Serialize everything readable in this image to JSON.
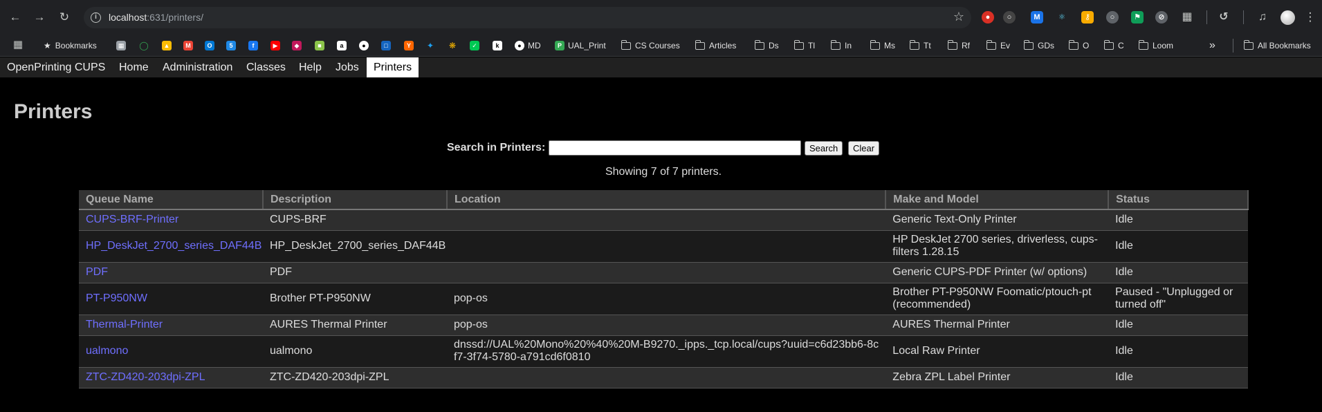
{
  "browser": {
    "url_host": "localhost",
    "url_rest": ":631/printers/",
    "bookmarks": [
      {
        "label": "Bookmarks",
        "type": "star"
      },
      {
        "label": "MD",
        "type": "favicon",
        "color": "#333"
      },
      {
        "label": "UAL_Print",
        "type": "favicon",
        "color": "#34a853"
      },
      {
        "label": "CS Courses",
        "type": "folder"
      },
      {
        "label": "Articles",
        "type": "folder"
      },
      {
        "label": "Ds",
        "type": "folder"
      },
      {
        "label": "Tl",
        "type": "folder"
      },
      {
        "label": "In",
        "type": "folder"
      },
      {
        "label": "Ms",
        "type": "folder"
      },
      {
        "label": "Tt",
        "type": "folder"
      },
      {
        "label": "Rf",
        "type": "folder"
      },
      {
        "label": "Ev",
        "type": "folder"
      },
      {
        "label": "GDs",
        "type": "folder"
      },
      {
        "label": "O",
        "type": "folder"
      },
      {
        "label": "C",
        "type": "folder"
      },
      {
        "label": "Loom",
        "type": "folder"
      }
    ],
    "all_bookmarks": "All Bookmarks"
  },
  "menu": {
    "brand": "OpenPrinting CUPS",
    "items": [
      "Home",
      "Administration",
      "Classes",
      "Help",
      "Jobs",
      "Printers"
    ],
    "active": "Printers"
  },
  "page": {
    "title": "Printers",
    "search_label": "Search in Printers:",
    "search_value": "",
    "search_button": "Search",
    "clear_button": "Clear",
    "showing": "Showing 7 of 7 printers."
  },
  "table": {
    "headers": [
      "Queue Name",
      "Description",
      "Location",
      "Make and Model",
      "Status"
    ],
    "rows": [
      {
        "queue": "CUPS-BRF-Printer",
        "description": "CUPS-BRF",
        "location": "",
        "model": "Generic Text-Only Printer",
        "status": "Idle"
      },
      {
        "queue": "HP_DeskJet_2700_series_DAF44B",
        "description": "HP_DeskJet_2700_series_DAF44B",
        "location": "",
        "model": "HP DeskJet 2700 series, driverless, cups-filters 1.28.15",
        "status": "Idle"
      },
      {
        "queue": "PDF",
        "description": "PDF",
        "location": "",
        "model": "Generic CUPS-PDF Printer (w/ options)",
        "status": "Idle"
      },
      {
        "queue": "PT-P950NW",
        "description": "Brother PT-P950NW",
        "location": "pop-os",
        "model": "Brother PT-P950NW Foomatic/ptouch-pt (recommended)",
        "status": "Paused - \"Unplugged or turned off\""
      },
      {
        "queue": "Thermal-Printer",
        "description": "AURES Thermal Printer",
        "location": "pop-os",
        "model": "AURES Thermal Printer",
        "status": "Idle"
      },
      {
        "queue": "ualmono",
        "description": "ualmono",
        "location": "dnssd://UAL%20Mono%20%40%20M-B9270._ipps._tcp.local/cups?uuid=c6d23bb6-8cf7-3f74-5780-a791cd6f0810",
        "model": "Local Raw Printer",
        "status": "Idle"
      },
      {
        "queue": "ZTC-ZD420-203dpi-ZPL",
        "description": "ZTC-ZD420-203dpi-ZPL",
        "location": "",
        "model": "Zebra ZPL Label Printer",
        "status": "Idle"
      }
    ]
  }
}
